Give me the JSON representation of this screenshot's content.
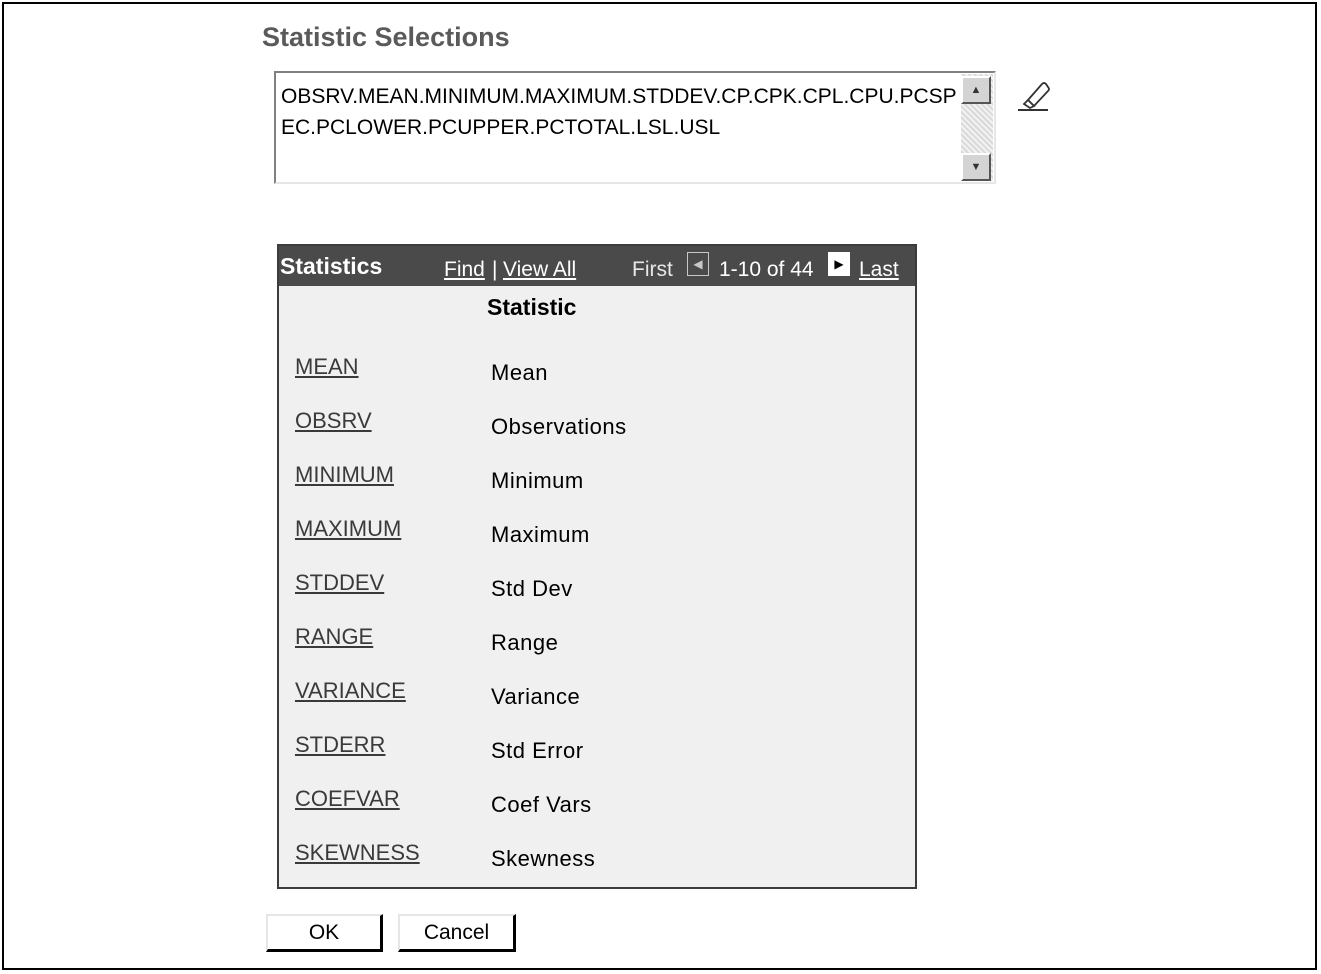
{
  "page": {
    "heading": "Statistic Selections",
    "selections_value": "OBSRV.MEAN.MINIMUM.MAXIMUM.STDDEV.CP.CPK.CPL.CPU.PCSPEC.PCLOWER.PCUPPER.PCTOTAL.LSL.USL",
    "clear_icon": "eraser-icon"
  },
  "grid": {
    "title": "Statistics",
    "find": "Find",
    "separator": "|",
    "view_all": "View All",
    "first": "First",
    "range": "1-10 of 44",
    "last": "Last",
    "column_header": "Statistic",
    "rows": [
      {
        "code": "MEAN",
        "description": "Mean"
      },
      {
        "code": "OBSRV",
        "description": "Observations"
      },
      {
        "code": "MINIMUM",
        "description": "Minimum"
      },
      {
        "code": "MAXIMUM",
        "description": "Maximum"
      },
      {
        "code": "STDDEV",
        "description": "Std Dev"
      },
      {
        "code": "RANGE",
        "description": "Range"
      },
      {
        "code": "VARIANCE",
        "description": "Variance"
      },
      {
        "code": "STDERR",
        "description": "Std Error"
      },
      {
        "code": "COEFVAR",
        "description": "Coef Vars"
      },
      {
        "code": "SKEWNESS",
        "description": "Skewness"
      }
    ]
  },
  "buttons": {
    "ok": "OK",
    "cancel": "Cancel"
  },
  "colors": {
    "grid_header_bg": "#4a4a4a",
    "grid_body_bg": "#f0f0f0",
    "heading": "#5a5a5a"
  }
}
